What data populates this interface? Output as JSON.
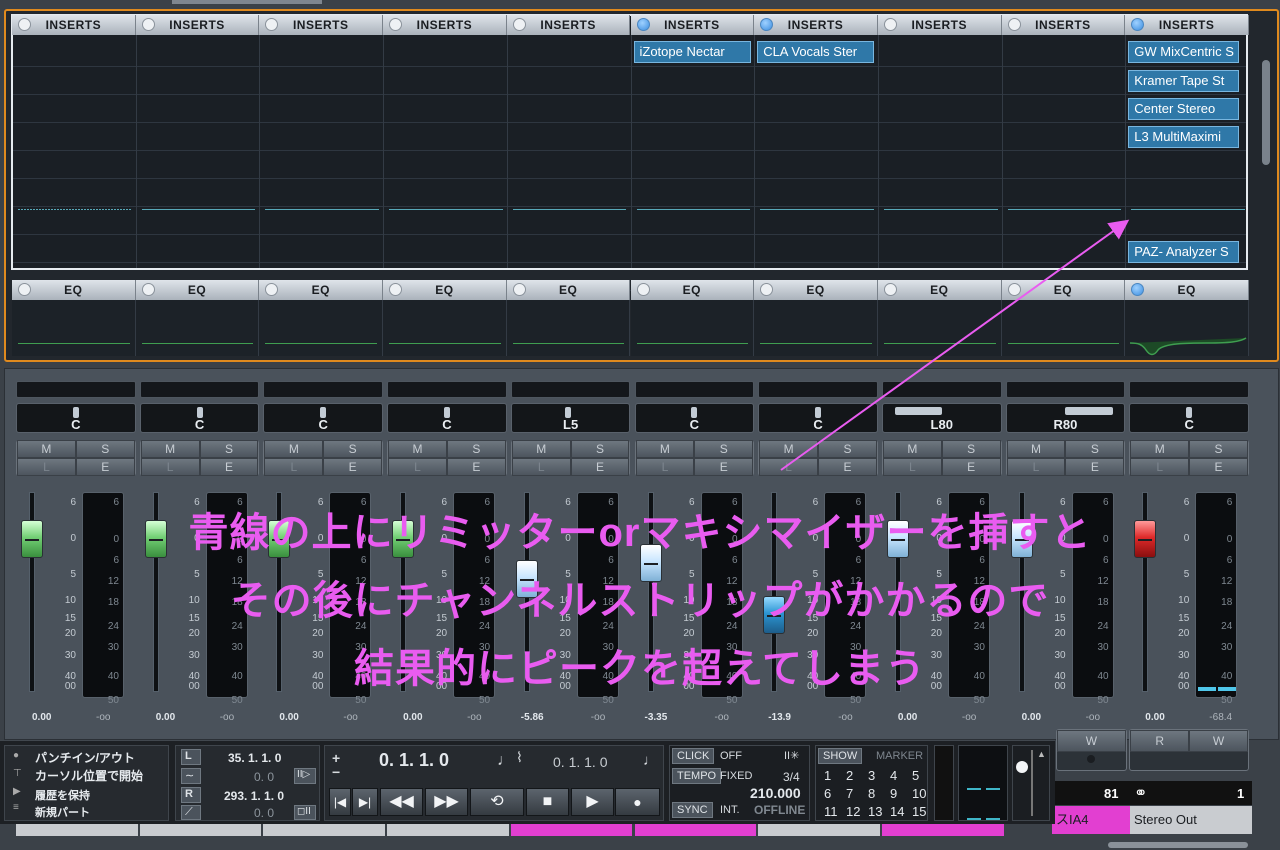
{
  "inserts_rack": {
    "title": "INSERTS",
    "channels": [
      {
        "active": false,
        "slots": []
      },
      {
        "active": false,
        "slots": []
      },
      {
        "active": false,
        "slots": []
      },
      {
        "active": false,
        "slots": []
      },
      {
        "active": false,
        "slots": []
      },
      {
        "active": true,
        "slots": [
          "iZotope Nectar"
        ]
      },
      {
        "active": true,
        "slots": [
          "CLA Vocals Ster"
        ]
      },
      {
        "active": false,
        "slots": []
      },
      {
        "active": false,
        "slots": []
      },
      {
        "active": true,
        "slots": [
          "GW MixCentric S",
          "Kramer Tape St",
          "Center Stereo",
          "L3 MultiMaximi",
          "PAZ- Analyzer S"
        ]
      }
    ]
  },
  "eq_rack": {
    "title": "EQ",
    "active": [
      false,
      false,
      false,
      false,
      false,
      false,
      false,
      false,
      false,
      true
    ]
  },
  "mixer": {
    "pan": [
      "C",
      "C",
      "C",
      "C",
      "L5",
      "C",
      "C",
      "L80",
      "R80",
      "C"
    ],
    "pan_fraction": [
      0.5,
      0.5,
      0.5,
      0.5,
      0.475,
      0.5,
      0.5,
      0.1,
      0.9,
      0.5
    ],
    "buttons": {
      "m": "M",
      "s": "S",
      "l": "L",
      "e": "E",
      "r": "R",
      "w": "W"
    },
    "fader_scale": [
      "6",
      "0",
      "5",
      "10",
      "15",
      "20",
      "30",
      "40",
      "00"
    ],
    "meter_scale": [
      "6",
      "0",
      "6",
      "12",
      "18",
      "24",
      "30",
      "40",
      "50"
    ],
    "volume": [
      "0.00",
      "0.00",
      "0.00",
      "0.00",
      "-5.86",
      "-3.35",
      "-13.9",
      "0.00",
      "0.00",
      "0.00"
    ],
    "peak": [
      "-oo",
      "-oo",
      "-oo",
      "-oo",
      "-oo",
      "-oo",
      "-oo",
      "-oo",
      "-oo",
      "-68.4"
    ],
    "fader_color": [
      "green",
      "green",
      "green",
      "green",
      "white",
      "white",
      "blue",
      "white",
      "white",
      "red"
    ],
    "fader_level_db": [
      0,
      0,
      0,
      0,
      -5.86,
      -3.35,
      -13.9,
      0,
      0,
      0
    ],
    "channel_numbers": [
      "81",
      "1"
    ],
    "channel_names": [
      "スIA4",
      "Stereo Out"
    ]
  },
  "transport": {
    "menu": [
      "パンチイン/アウト",
      "カーソル位置で開始",
      "履歴を保持",
      "新規パート"
    ],
    "left_locator": "35. 1. 1.   0",
    "left_sub": "0.   0",
    "right_locator": "293. 1. 1.   0",
    "right_sub": "0.   0",
    "primary_position": "0. 1. 1.   0",
    "secondary_position": "0. 1. 1.   0",
    "click_label": "CLICK",
    "click_value": "OFF",
    "tempo_label": "TEMPO",
    "tempo_mode": "FIXED",
    "signature": "3/4",
    "tempo_value": "210.000",
    "sync_label": "SYNC",
    "sync_mode": "INT.",
    "sync_status": "OFFLINE",
    "show_label": "SHOW",
    "marker_label": "MARKER",
    "markers": [
      "1",
      "2",
      "3",
      "4",
      "5",
      "6",
      "7",
      "8",
      "9",
      "10",
      "11",
      "12",
      "13",
      "14",
      "15"
    ],
    "buttons": [
      "|◀",
      "▶|",
      "◀◀",
      "▶▶",
      "⟲",
      "■",
      "▶",
      "●"
    ]
  },
  "annotation": {
    "lines": [
      "青線の上にリミッターorマキシマイザーを挿すと",
      "その後にチャンネルストリップがかかるので",
      "結果的にピークを超えてしまう"
    ],
    "color": "#e95cf0"
  },
  "colors": {
    "rack_border": "#e08a1e",
    "slot_blue": "#2f78a8",
    "magenta_channel": "#e23fd1"
  }
}
